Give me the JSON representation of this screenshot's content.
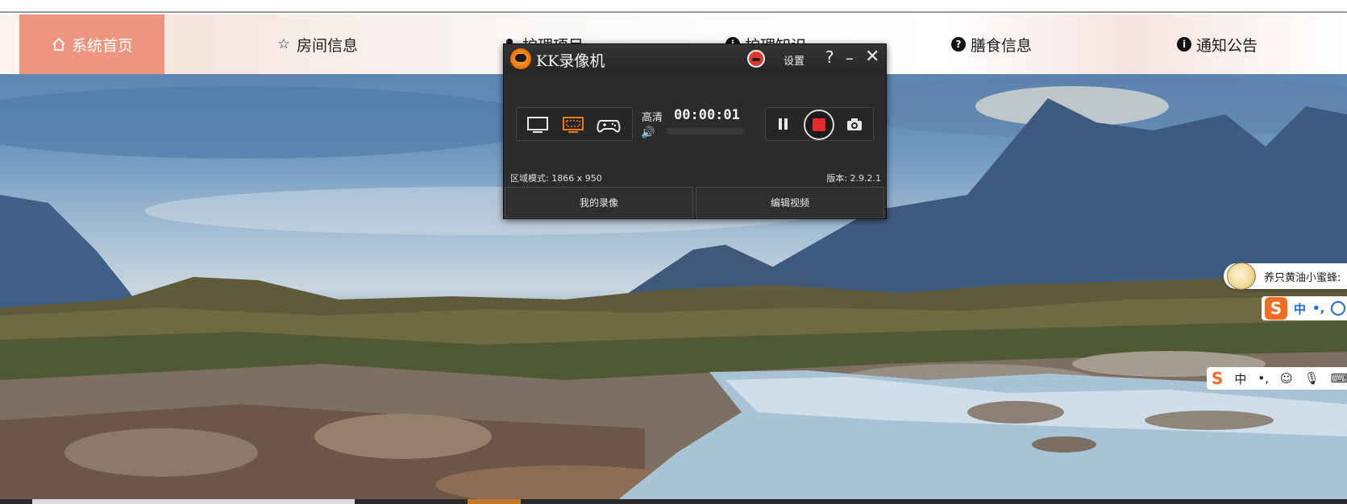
{
  "nav": {
    "items": [
      {
        "label": "系统首页",
        "icon": "home-icon",
        "active": true
      },
      {
        "label": "房间信息",
        "icon": "star-icon"
      },
      {
        "label": "护理项目",
        "icon": "user-icon"
      },
      {
        "label": "护理知识",
        "icon": "info-icon"
      },
      {
        "label": "膳食信息",
        "icon": "question-icon"
      },
      {
        "label": "通知公告",
        "icon": "info-icon"
      }
    ],
    "active_color": "#EE9580"
  },
  "recorder": {
    "app_name": "KK录像机",
    "settings_label": "设置",
    "help_label": "?",
    "minimize_label": "–",
    "close_label": "✕",
    "quality_label": "高清",
    "timer": "00:00:01",
    "modes": [
      {
        "name": "fullscreen-mode",
        "icon": "monitor-icon"
      },
      {
        "name": "region-mode",
        "icon": "region-icon",
        "selected": true
      },
      {
        "name": "game-mode",
        "icon": "gamepad-icon"
      }
    ],
    "region_mode_text": "区域模式: 1866 x 950",
    "version_text": "版本: 2.9.2.1",
    "tabs": {
      "my_recordings": "我的录像",
      "edit_video": "编辑视频"
    },
    "accent_color": "#F07A10",
    "record_color": "#E62A2A"
  },
  "ime": {
    "tip_text": "养只黄油小蜜蜂:",
    "logo_letter": "S",
    "mode_char": "中",
    "punct_char": "•,",
    "big_bar": {
      "logo": "S",
      "mode_char": "中",
      "punct_char": "•,",
      "emoji_label": "☺",
      "mic_label": "🎙",
      "keyboard_label": "⌨"
    }
  }
}
